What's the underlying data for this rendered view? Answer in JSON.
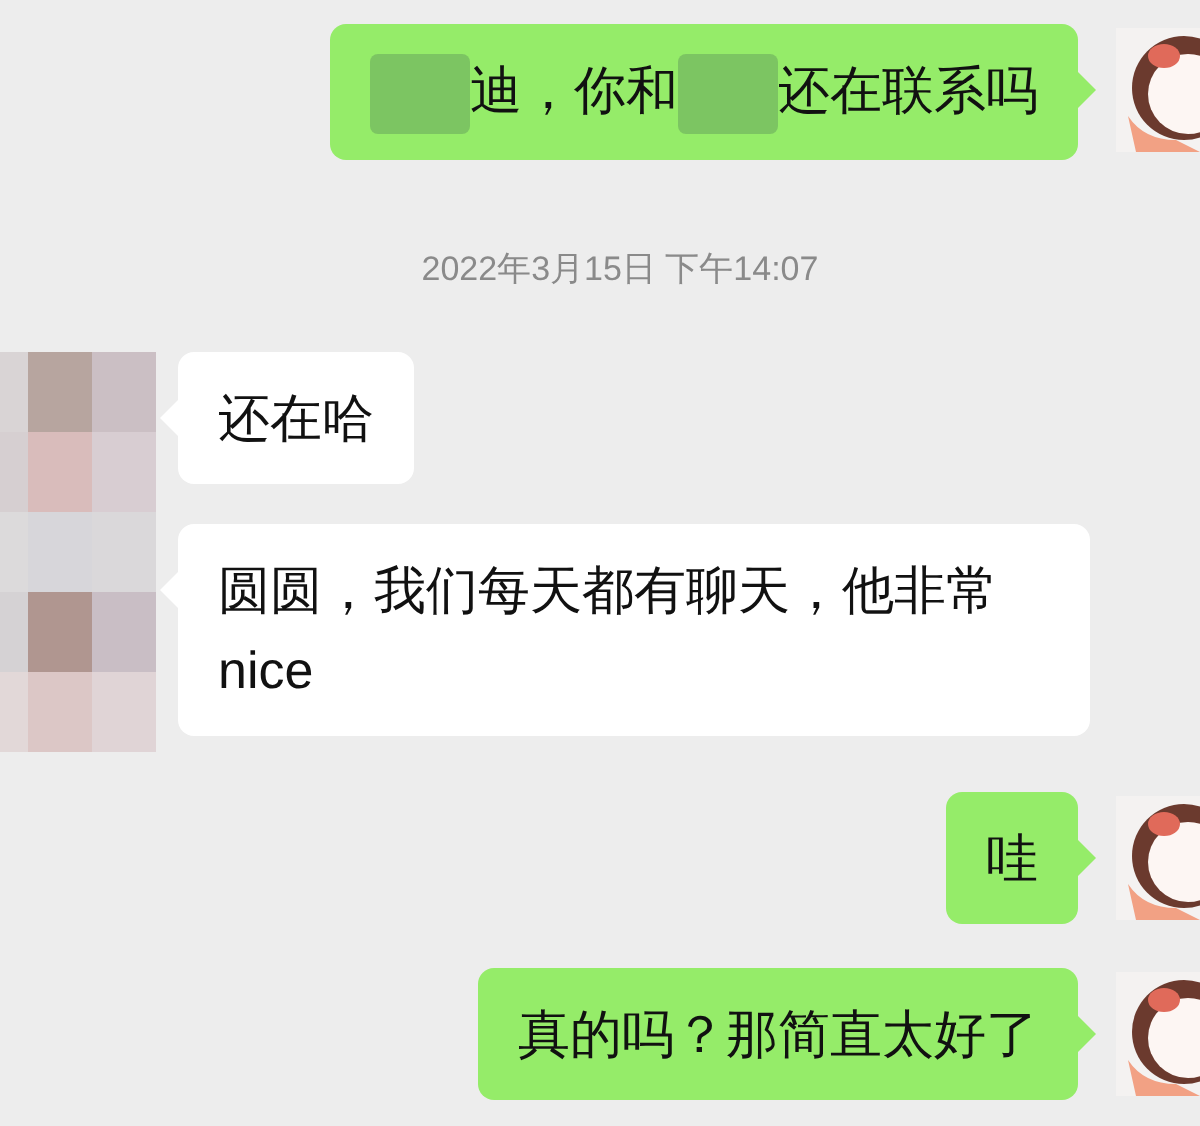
{
  "chat": [
    {
      "kind": "message",
      "outgoing": true,
      "parts": [
        {
          "kind": "redacted"
        },
        {
          "kind": "text",
          "text": "迪，你和"
        },
        {
          "kind": "redacted"
        },
        {
          "kind": "text",
          "text": "还在联系吗"
        }
      ]
    },
    {
      "kind": "timestamp",
      "text": "2022年3月15日 下午14:07"
    },
    {
      "kind": "group",
      "outgoing": false,
      "messages": [
        {
          "parts": [
            {
              "kind": "text",
              "text": "还在哈"
            }
          ]
        },
        {
          "parts": [
            {
              "kind": "text",
              "text": "圆圆，我们每天都有聊天，他非常nice"
            }
          ]
        }
      ]
    },
    {
      "kind": "message",
      "outgoing": true,
      "parts": [
        {
          "kind": "text",
          "text": "哇"
        }
      ]
    },
    {
      "kind": "message",
      "outgoing": true,
      "parts": [
        {
          "kind": "text",
          "text": "真的吗？那简直太好了"
        }
      ]
    }
  ]
}
